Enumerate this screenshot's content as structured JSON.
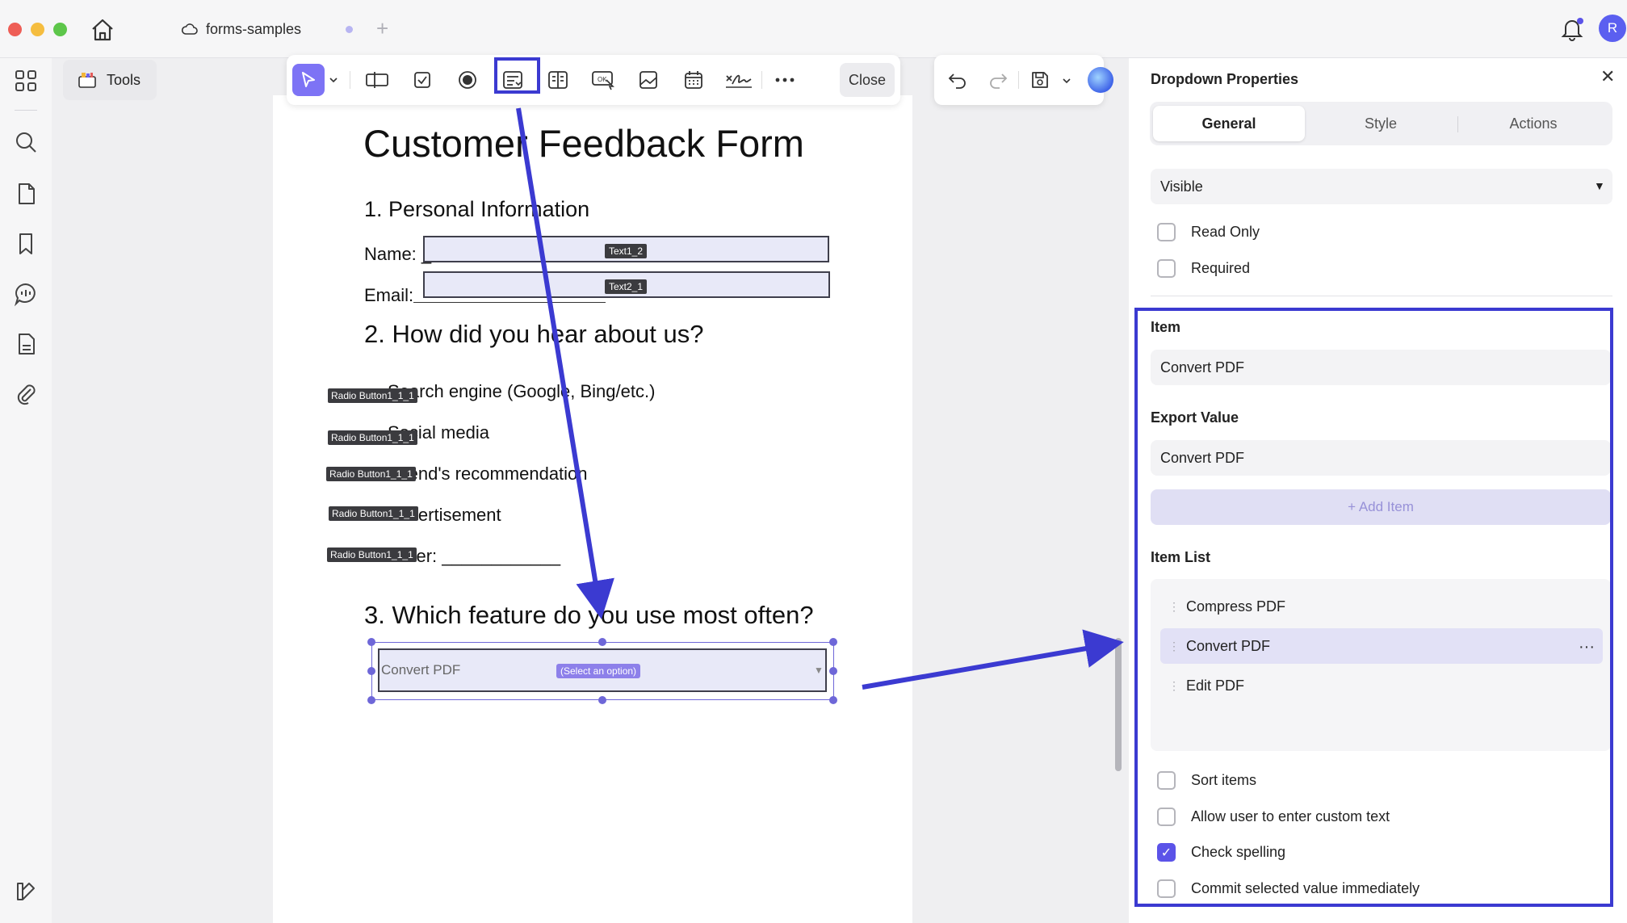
{
  "app": {
    "tab_name": "forms-samples",
    "tools_label": "Tools",
    "close_label": "Close",
    "avatar_initial": "R"
  },
  "document": {
    "title": "Customer Feedback Form",
    "section1": "1. Personal Information",
    "name_label": "Name: _",
    "email_label": "Email: ",
    "name_field_tag": "Text1_2",
    "email_field_tag": "Text2_1",
    "section2": "2. How did you hear about us?",
    "options": [
      "Search engine (Google, Bing/etc.)",
      "Social media",
      "Friend's recommendation",
      "Advertisement",
      "Other: ____________"
    ],
    "radio_tags": [
      "Radio Button1_1_1",
      "Radio Button1_1_1",
      "Radio Button1_1_1",
      "Radio Button1_1_1",
      "Radio Button1_1_1"
    ],
    "section3": "3. Which feature do you use most often?",
    "dropdown_value": "Convert PDF",
    "dropdown_tag": "(Select an option)"
  },
  "panel": {
    "title": "Dropdown Properties",
    "tabs": [
      "General",
      "Style",
      "Actions"
    ],
    "visibility": "Visible",
    "read_only": "Read Only",
    "required": "Required",
    "item_label": "Item",
    "item_value": "Convert PDF",
    "export_label": "Export Value",
    "export_value": "Convert PDF",
    "add_item": "+ Add Item",
    "item_list_label": "Item List",
    "item_list": [
      "Compress PDF",
      "Convert PDF",
      "Edit PDF"
    ],
    "options": [
      {
        "label": "Sort items",
        "checked": false
      },
      {
        "label": "Allow user to enter custom text",
        "checked": false
      },
      {
        "label": "Check spelling",
        "checked": true
      },
      {
        "label": "Commit selected value immediately",
        "checked": false
      }
    ]
  },
  "colors": {
    "accent": "#5b53e8",
    "annotation": "#3b3ad1",
    "field_fill": "#e8e9f8"
  }
}
